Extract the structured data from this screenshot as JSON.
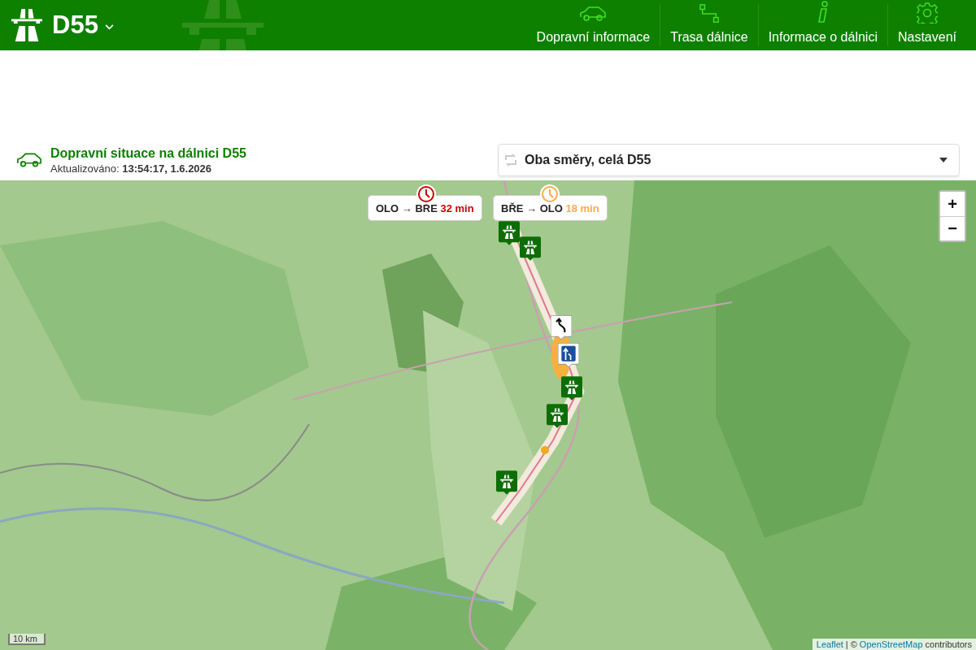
{
  "header": {
    "title": "D55",
    "nav": [
      {
        "label": "Dopravní informace"
      },
      {
        "label": "Trasa dálnice"
      },
      {
        "label": "Informace o dálnici"
      },
      {
        "label": "Nastavení"
      }
    ]
  },
  "situation": {
    "title": "Dopravní situace na dálnici D55",
    "updated_label": "Aktualizováno:",
    "updated_value": "13:54:17, 1.6.2026"
  },
  "direction_select": {
    "value": "Oba směry, celá D55"
  },
  "map": {
    "kind": "picture",
    "travel_times": [
      {
        "route": "OLO → BŘE",
        "time": "32 min",
        "color": "#cc0000"
      },
      {
        "route": "BŘE → OLO",
        "time": "18 min",
        "color": "#ffa94d"
      }
    ],
    "markers": [
      {
        "kind": "motorway"
      },
      {
        "kind": "motorway"
      },
      {
        "kind": "detour"
      },
      {
        "kind": "lane"
      },
      {
        "kind": "motorway"
      },
      {
        "kind": "motorway"
      },
      {
        "kind": "motorway"
      }
    ],
    "zoom": [
      "+",
      "−"
    ],
    "scale": "10 km",
    "attribution": {
      "link1": "Leaflet",
      "separator": "| ©",
      "link2": "OpenStreetMap",
      "suffix": "contributors"
    }
  }
}
